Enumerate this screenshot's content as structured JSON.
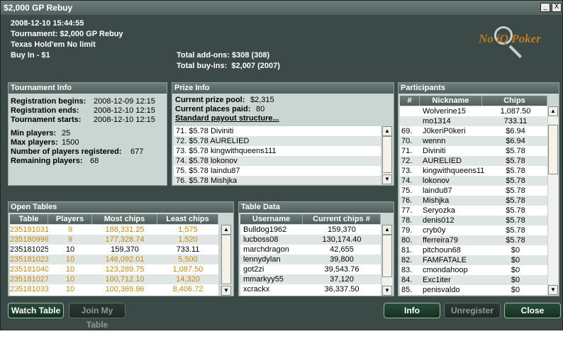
{
  "window": {
    "title": "$2,000 GP Rebuy",
    "minimize_glyph": "_",
    "close_glyph": "X"
  },
  "header": {
    "datetime": "2008-12-10 15:44:55",
    "tournament": "Tournament: $2,000 GP Rebuy",
    "game": "Texas Hold'em No limit",
    "buy_in": "Buy In - $1",
    "total_addons": "Total add-ons: $308 (308)",
    "total_buyins": "Total buy-ins:  $2,007 (2007)",
    "logo_text": "No iQ Poker"
  },
  "tournament_info": {
    "title": "Tournament Info",
    "registration_begins_label": "Registration begins:",
    "registration_begins_value": "2008-12-09 12:15",
    "registration_ends_label": "Registration ends:",
    "registration_ends_value": "2008-12-10 12:15",
    "tournament_starts_label": "Tournament starts:",
    "tournament_starts_value": "2008-12-10 12:15",
    "min_players_label": "Min players:",
    "min_players_value": "25",
    "max_players_label": "Max players:",
    "max_players_value": "1500",
    "registered_label": "Number of players registered:",
    "registered_value": "677",
    "remaining_label": "Remaining players:",
    "remaining_value": "68"
  },
  "prize_info": {
    "title": "Prize Info",
    "prize_pool_label": "Current prize pool:",
    "prize_pool_value": "$2,315",
    "places_paid_label": "Current places paid:",
    "places_paid_value": "80",
    "payout_link": "Standard payout structure...",
    "rows": [
      {
        "place": "71.",
        "amount": "$5.78",
        "name": "Diviniti"
      },
      {
        "place": "72.",
        "amount": "$5.78",
        "name": "AURELIED"
      },
      {
        "place": "73.",
        "amount": "$5.78",
        "name": "kingwithqueens111"
      },
      {
        "place": "74.",
        "amount": "$5.78",
        "name": "lokonov"
      },
      {
        "place": "75.",
        "amount": "$5.78",
        "name": "laindu87"
      },
      {
        "place": "76.",
        "amount": "$5.78",
        "name": "Mishjka"
      }
    ]
  },
  "participants": {
    "title": "Participants",
    "columns": [
      "#",
      "Nickname",
      "Chips"
    ],
    "rows": [
      {
        "rank": "",
        "nick": "Wolverine15",
        "chips": "1,087.50"
      },
      {
        "rank": "",
        "nick": "mo1314",
        "chips": "733.11"
      },
      {
        "rank": "69.",
        "nick": "J0keriP0keri",
        "chips": "$6.94"
      },
      {
        "rank": "70.",
        "nick": "wennn",
        "chips": "$6.94"
      },
      {
        "rank": "71.",
        "nick": "Diviniti",
        "chips": "$5.78"
      },
      {
        "rank": "72.",
        "nick": "AURELIED",
        "chips": "$5.78"
      },
      {
        "rank": "73.",
        "nick": "kingwithqueens11",
        "chips": "$5.78"
      },
      {
        "rank": "74.",
        "nick": "lokonov",
        "chips": "$5.78"
      },
      {
        "rank": "75.",
        "nick": "laindu87",
        "chips": "$5.78"
      },
      {
        "rank": "76.",
        "nick": "Mishjka",
        "chips": "$5.78"
      },
      {
        "rank": "77.",
        "nick": "Seryozka",
        "chips": "$5.78"
      },
      {
        "rank": "78.",
        "nick": "denis012",
        "chips": "$5.78"
      },
      {
        "rank": "79.",
        "nick": "cryb0y",
        "chips": "$5.78"
      },
      {
        "rank": "80.",
        "nick": "fferreira79",
        "chips": "$5.78"
      },
      {
        "rank": "81.",
        "nick": "pitchoun68",
        "chips": "$0"
      },
      {
        "rank": "82.",
        "nick": "FAMFATALE",
        "chips": "$0"
      },
      {
        "rank": "83.",
        "nick": "cmondahoop",
        "chips": "$0"
      },
      {
        "rank": "84.",
        "nick": "Exc1iter",
        "chips": "$0"
      },
      {
        "rank": "85.",
        "nick": "penisvaldo",
        "chips": "$0"
      }
    ]
  },
  "open_tables": {
    "title": "Open Tables",
    "columns": [
      "Table",
      "Players",
      "Most chips",
      "Least chips"
    ],
    "rows": [
      {
        "table": "235181031",
        "players": "9",
        "most": "188,331.25",
        "least": "1,575",
        "highlight": true
      },
      {
        "table": "235180999",
        "players": "9",
        "most": "177,328.74",
        "least": "1,520",
        "highlight": true
      },
      {
        "table": "235181025",
        "players": "10",
        "most": "159,370",
        "least": "733.11",
        "highlight": false
      },
      {
        "table": "235181023",
        "players": "10",
        "most": "146,092.01",
        "least": "5,500",
        "highlight": true
      },
      {
        "table": "235181040",
        "players": "10",
        "most": "123,289.75",
        "least": "1,087.50",
        "highlight": true
      },
      {
        "table": "235181027",
        "players": "10",
        "most": "100,712.10",
        "least": "14,320",
        "highlight": true
      },
      {
        "table": "235181033",
        "players": "10",
        "most": "100,369.96",
        "least": "8,406.72",
        "highlight": true
      }
    ]
  },
  "table_data": {
    "title": "Table Data",
    "columns": [
      "Username",
      "Current chips #"
    ],
    "rows": [
      {
        "user": "Bulldog1962",
        "chips": "159,370"
      },
      {
        "user": "lucboss08",
        "chips": "130,174.40"
      },
      {
        "user": "marchdragon",
        "chips": "42,655"
      },
      {
        "user": "lennydylan",
        "chips": "39,800"
      },
      {
        "user": "got2zi",
        "chips": "39,543.76"
      },
      {
        "user": "mmarkyy55",
        "chips": "37,120"
      },
      {
        "user": "xcrackx",
        "chips": "36,337.50"
      }
    ]
  },
  "buttons": {
    "watch_table": "Watch Table",
    "join_my_table": "Join My Table",
    "info": "Info",
    "unregister": "Unregister",
    "close": "Close"
  },
  "colors": {
    "window_bg": "#3c4a47",
    "panel_bg": "#c9d6d2",
    "highlight_text": "#c58a10",
    "button_bg": "#1f3f2e"
  }
}
